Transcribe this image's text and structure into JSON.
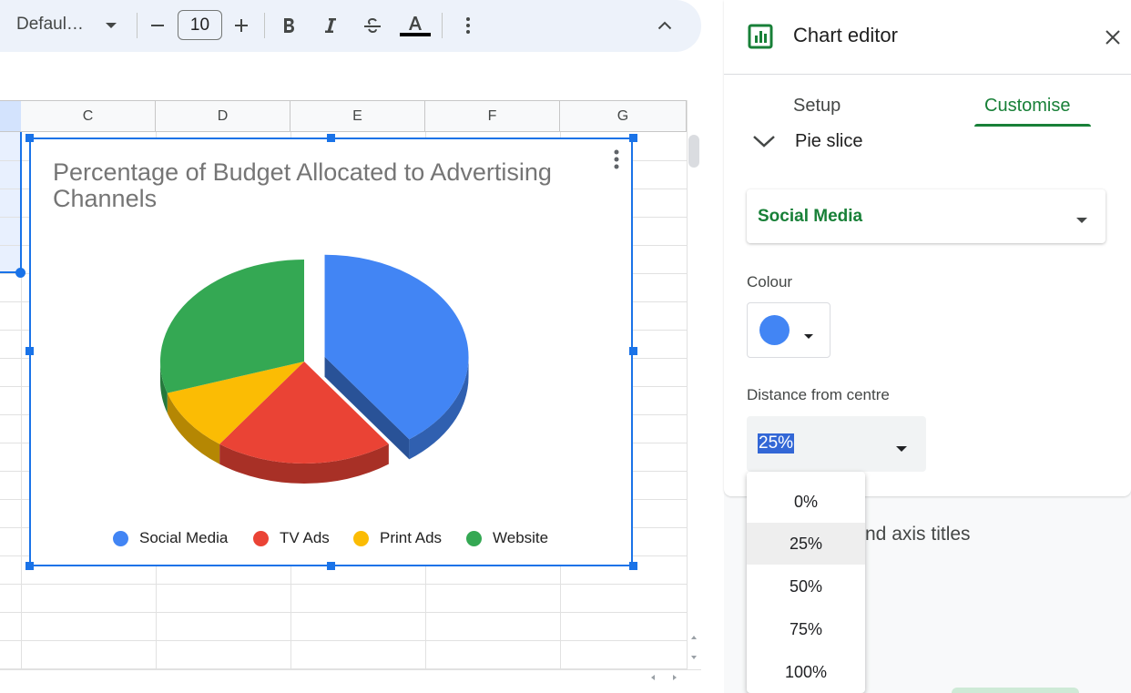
{
  "toolbar": {
    "font_name": "Defaul…",
    "font_size": "10",
    "icons": [
      "chevron-down-icon",
      "minus-icon",
      "plus-icon",
      "bold-icon",
      "italic-icon",
      "strikethrough-icon",
      "text-color-icon",
      "more-vert-icon",
      "chevron-up-icon"
    ],
    "text_color_bar": "#000000"
  },
  "sheet": {
    "columns": [
      "C",
      "D",
      "E",
      "F",
      "G"
    ]
  },
  "chart": {
    "title": "Percentage of Budget Allocated to Advertising Channels",
    "legend": [
      {
        "label": "Social Media",
        "color": "#4285f4"
      },
      {
        "label": "TV Ads",
        "color": "#ea4335"
      },
      {
        "label": "Print Ads",
        "color": "#fbbc04"
      },
      {
        "label": "Website",
        "color": "#34a853"
      }
    ]
  },
  "chart_data": {
    "type": "pie",
    "title": "Percentage of Budget Allocated to Advertising Channels",
    "labels": [
      "Social Media",
      "TV Ads",
      "Print Ads",
      "Website"
    ],
    "values": [
      40,
      20,
      10,
      30
    ],
    "colors": [
      "#4285f4",
      "#ea4335",
      "#fbbc04",
      "#34a853"
    ],
    "exploded_slice": "Social Media",
    "explode_distance_percent": 25,
    "three_d": true,
    "legend_position": "bottom"
  },
  "editor": {
    "title": "Chart editor",
    "tabs": {
      "setup": "Setup",
      "customise": "Customise"
    },
    "section": "Pie slice",
    "series_selected": "Social Media",
    "colour_label": "Colour",
    "colour_value": "#4285f4",
    "distance_label": "Distance from centre",
    "distance_value": "25%",
    "hidden_section": "nd axis titles",
    "distance_options": [
      "0%",
      "25%",
      "50%",
      "75%",
      "100%"
    ],
    "accent": "#188038"
  }
}
